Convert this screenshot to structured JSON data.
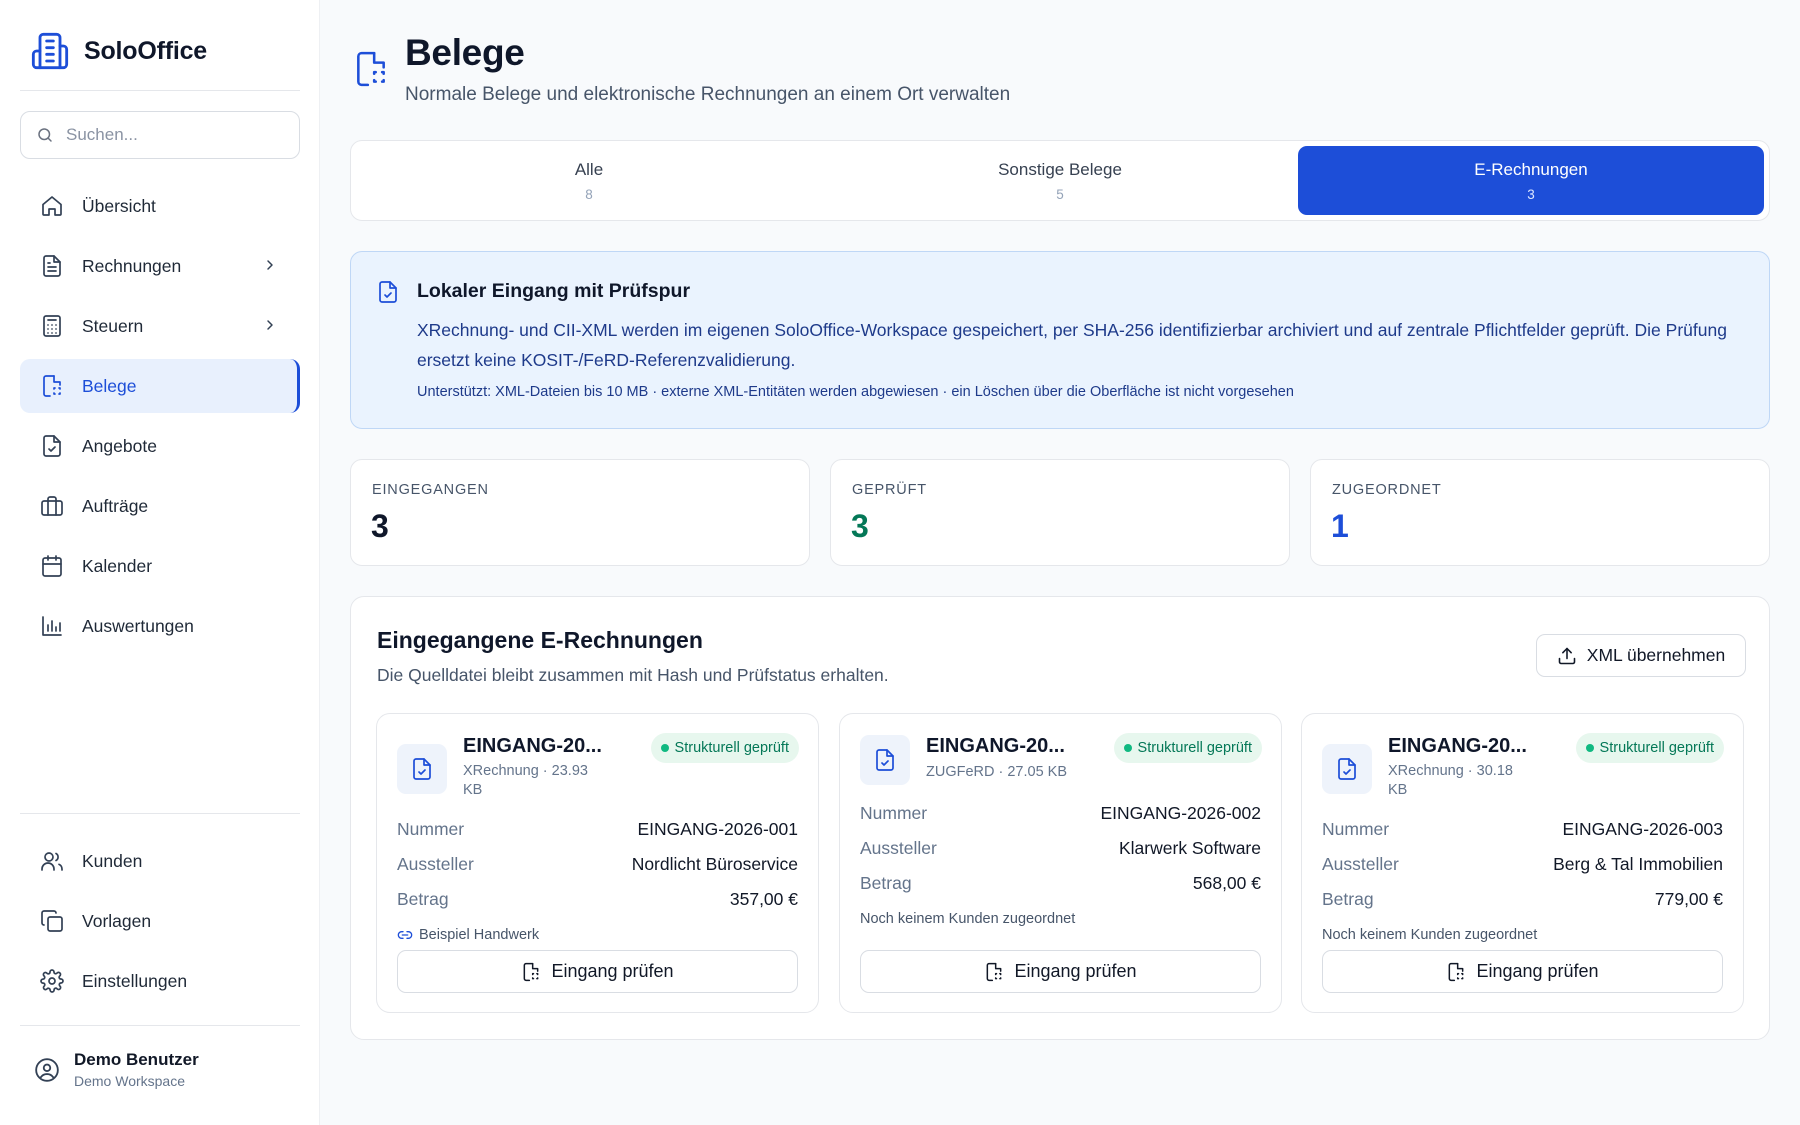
{
  "app": {
    "name": "SoloOffice"
  },
  "search": {
    "placeholder": "Suchen..."
  },
  "sidebar": {
    "items": [
      {
        "label": "Übersicht"
      },
      {
        "label": "Rechnungen"
      },
      {
        "label": "Steuern"
      },
      {
        "label": "Belege"
      },
      {
        "label": "Angebote"
      },
      {
        "label": "Aufträge"
      },
      {
        "label": "Kalender"
      },
      {
        "label": "Auswertungen"
      }
    ],
    "bottom_items": [
      {
        "label": "Kunden"
      },
      {
        "label": "Vorlagen"
      },
      {
        "label": "Einstellungen"
      }
    ],
    "active": "Belege"
  },
  "user": {
    "name": "Demo Benutzer",
    "workspace": "Demo Workspace"
  },
  "header": {
    "title": "Belege",
    "subtitle": "Normale Belege und elektronische Rechnungen an einem Ort verwalten"
  },
  "tabs": [
    {
      "label": "Alle",
      "count": "8"
    },
    {
      "label": "Sonstige Belege",
      "count": "5"
    },
    {
      "label": "E-Rechnungen",
      "count": "3"
    }
  ],
  "info": {
    "title": "Lokaler Eingang mit Prüfspur",
    "text": "XRechnung- und CII-XML werden im eigenen SoloOffice-Workspace gespeichert, per SHA-256 identifizierbar archiviert und auf zentrale Pflichtfelder geprüft. Die Prüfung ersetzt keine KOSIT-/FeRD-Referenzvalidierung.",
    "note": "Unterstützt: XML-Dateien bis 10 MB · externe XML-Entitäten werden abgewiesen · ein Löschen über die Oberfläche ist nicht vorgesehen"
  },
  "stats": [
    {
      "label": "EINGEGANGEN",
      "value": "3",
      "color": "#0f172a"
    },
    {
      "label": "GEPRÜFT",
      "value": "3",
      "color": "#047857"
    },
    {
      "label": "ZUGEORDNET",
      "value": "1",
      "color": "#1d4ed8"
    }
  ],
  "panel": {
    "title": "Eingegangene E-Rechnungen",
    "subtitle": "Die Quelldatei bleibt zusammen mit Hash und Prüfstatus erhalten.",
    "button_label": "XML übernehmen"
  },
  "cards": [
    {
      "title": "EINGANG-20...",
      "meta": "XRechnung · 23.93 KB",
      "status": "Strukturell geprüft",
      "number_label": "Nummer",
      "number": "EINGANG-2026-001",
      "issuer_label": "Aussteller",
      "issuer": "Nordlicht Büroservice",
      "amount_label": "Betrag",
      "amount": "357,00 €",
      "assignment": "Beispiel Handwerk",
      "action": "Eingang prüfen"
    },
    {
      "title": "EINGANG-20...",
      "meta": "ZUGFeRD · 27.05 KB",
      "status": "Strukturell geprüft",
      "number_label": "Nummer",
      "number": "EINGANG-2026-002",
      "issuer_label": "Aussteller",
      "issuer": "Klarwerk Software",
      "amount_label": "Betrag",
      "amount": "568,00 €",
      "assignment": "Noch keinem Kunden zugeordnet",
      "action": "Eingang prüfen"
    },
    {
      "title": "EINGANG-20...",
      "meta": "XRechnung · 30.18 KB",
      "status": "Strukturell geprüft",
      "number_label": "Nummer",
      "number": "EINGANG-2026-003",
      "issuer_label": "Aussteller",
      "issuer": "Berg & Tal Immobilien",
      "amount_label": "Betrag",
      "amount": "779,00 €",
      "assignment": "Noch keinem Kunden zugeordnet",
      "action": "Eingang prüfen"
    }
  ],
  "colors": {
    "accent": "#1d4ed8",
    "success": "#047857",
    "info_bg": "#eaf3fe"
  }
}
